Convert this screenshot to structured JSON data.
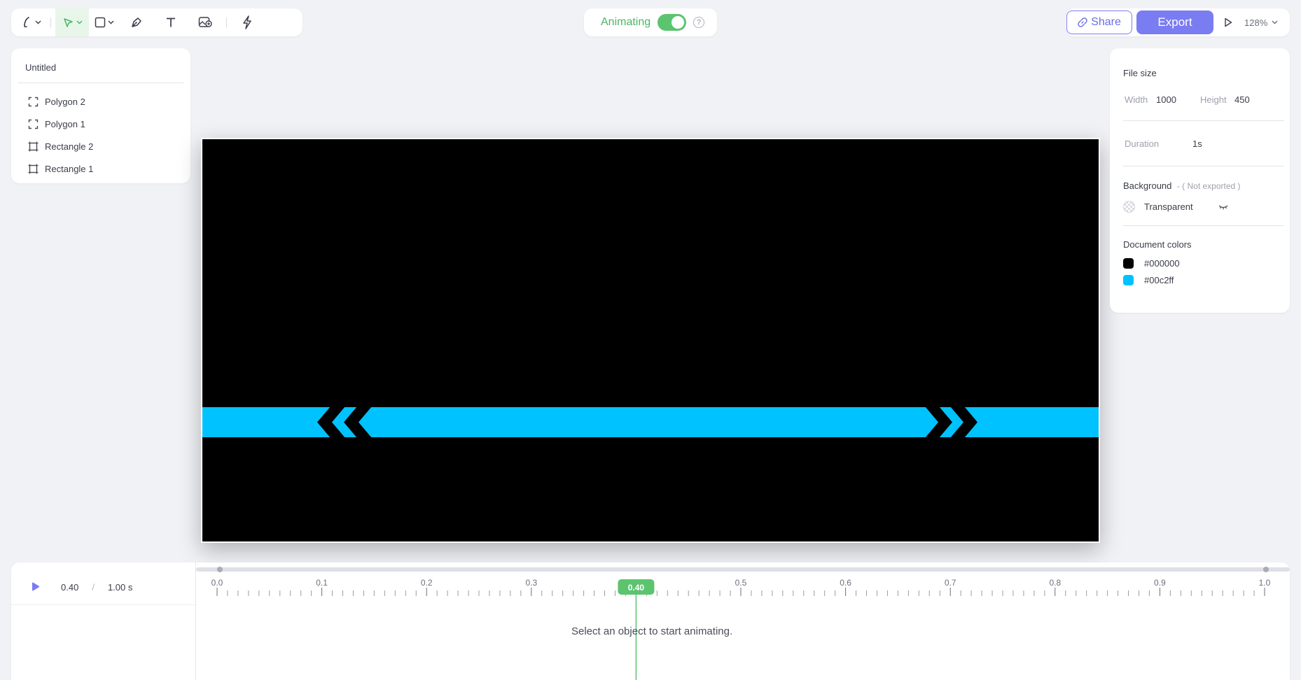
{
  "toolbar": {
    "tools": [
      "pencil-tool",
      "select-tool",
      "shape-tool",
      "pen-tool",
      "text-tool",
      "image-tool",
      "lightning-tool"
    ],
    "active_tool": "select-tool"
  },
  "animating": {
    "label": "Animating",
    "enabled": true
  },
  "header": {
    "share_label": "Share",
    "export_label": "Export",
    "zoom": "128%"
  },
  "layers": {
    "title": "Untitled",
    "items": [
      {
        "label": "Polygon 2",
        "icon": "polygon-icon"
      },
      {
        "label": "Polygon 1",
        "icon": "polygon-icon"
      },
      {
        "label": "Rectangle 2",
        "icon": "rectangle-icon"
      },
      {
        "label": "Rectangle 1",
        "icon": "rectangle-icon"
      }
    ]
  },
  "properties": {
    "file_size_title": "File size",
    "width_label": "Width",
    "width_value": "1000",
    "height_label": "Height",
    "height_value": "450",
    "duration_label": "Duration",
    "duration_value": "1s",
    "background_title": "Background",
    "background_note": "- ( Not exported )",
    "background_value": "Transparent",
    "doc_colors_title": "Document colors",
    "colors": [
      "#000000",
      "#00c2ff"
    ]
  },
  "timeline": {
    "current": "0.40",
    "separator": "/",
    "total": "1.00 s",
    "ticks": [
      "0.0",
      "0.1",
      "0.2",
      "0.3",
      "0.4",
      "0.5",
      "0.6",
      "0.7",
      "0.8",
      "0.9",
      "1.0"
    ],
    "playhead_position": 0.4,
    "playhead_label": "0.40",
    "empty_message": "Select an object to start animating."
  },
  "colors": {
    "accent": "#7a7cf2",
    "toggle": "#5cc46e",
    "canvas_bg": "#000000",
    "stripe": "#00c2ff"
  }
}
